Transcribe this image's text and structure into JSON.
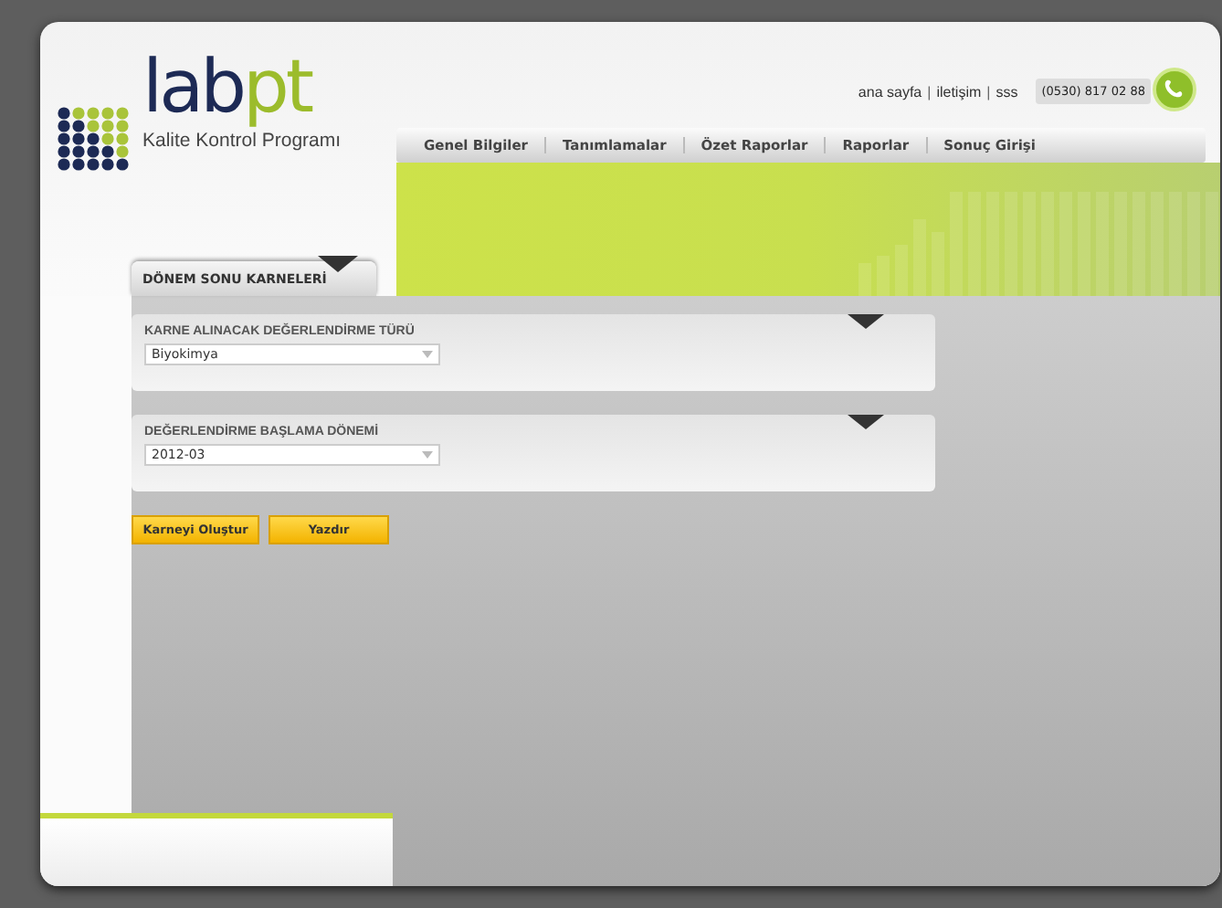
{
  "logo": {
    "name_part_1": "lab",
    "name_part_2": "pt",
    "tagline": "Kalite Kontrol Programı"
  },
  "top_links": [
    "ana sayfa",
    "iletişim",
    "sss"
  ],
  "link_separator": "|",
  "phone": "(0530) 817 02 88",
  "nav": [
    "Genel Bilgiler",
    "Tanımlamalar",
    "Özet Raporlar",
    "Raporlar",
    "Sonuç Girişi"
  ],
  "section_tab": "DÖNEM SONU KARNELERİ",
  "panels": [
    {
      "label": "KARNE ALINACAK DEĞERLENDİRME TÜRÜ",
      "value": "Biyokimya"
    },
    {
      "label": "DEĞERLENDİRME BAŞLAMA DÖNEMİ",
      "value": "2012-03"
    }
  ],
  "buttons": [
    "Karneyi Oluştur",
    "Yazdır"
  ]
}
